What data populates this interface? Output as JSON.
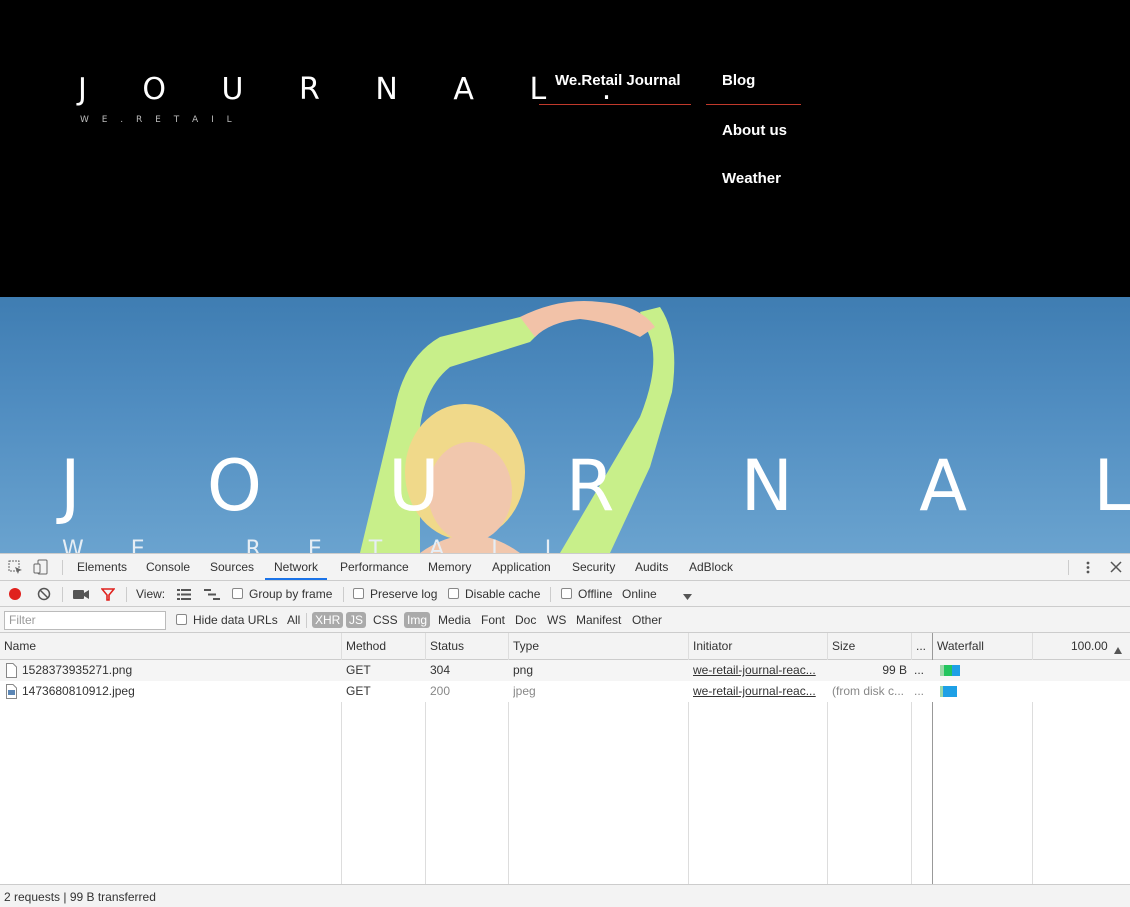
{
  "site": {
    "logo": {
      "title": "J O U R N A L .",
      "subtitle": "W E . R E T A I L"
    },
    "nav": {
      "items": [
        {
          "label": "We.Retail Journal"
        },
        {
          "label": "Blog"
        },
        {
          "label": "About us"
        },
        {
          "label": "Weather"
        }
      ],
      "accent": "#c0392b"
    },
    "hero": {
      "title": "J O U R N A L .",
      "subtitle": "W E . R E T A I L"
    }
  },
  "devtools": {
    "tabs": [
      {
        "label": "Elements"
      },
      {
        "label": "Console"
      },
      {
        "label": "Sources"
      },
      {
        "label": "Network"
      },
      {
        "label": "Performance"
      },
      {
        "label": "Memory"
      },
      {
        "label": "Application"
      },
      {
        "label": "Security"
      },
      {
        "label": "Audits"
      },
      {
        "label": "AdBlock"
      }
    ],
    "active_tab": "Network",
    "toolbar": {
      "view_label": "View:",
      "group_by_frame": "Group by frame",
      "preserve_log": "Preserve log",
      "disable_cache": "Disable cache",
      "offline": "Offline",
      "throttle": "Online"
    },
    "filter": {
      "placeholder": "Filter",
      "hide_data_urls": "Hide data URLs",
      "types": [
        "All",
        "XHR",
        "JS",
        "CSS",
        "Img",
        "Media",
        "Font",
        "Doc",
        "WS",
        "Manifest",
        "Other"
      ]
    },
    "columns": {
      "name": "Name",
      "method": "Method",
      "status": "Status",
      "type": "Type",
      "initiator": "Initiator",
      "size": "Size",
      "time": "...",
      "waterfall": "Waterfall",
      "waterfall_time": "100.00"
    },
    "requests": [
      {
        "name": "1528373935271.png",
        "method": "GET",
        "status": "304",
        "type": "png",
        "initiator": "we-retail-journal-reac...",
        "size": "99 B",
        "time": "..."
      },
      {
        "name": "1473680810912.jpeg",
        "method": "GET",
        "status": "200",
        "type": "jpeg",
        "initiator": "we-retail-journal-reac...",
        "size": "(from disk c...",
        "time": "..."
      }
    ],
    "status_bar": "2 requests | 99 B transferred",
    "colors": {
      "record": "#e0211d",
      "filter_icon": "#e0211d",
      "active_tab_underline": "#1a73e8",
      "waterfall_green": "#22c55e",
      "waterfall_blue": "#1ea0e6"
    }
  }
}
